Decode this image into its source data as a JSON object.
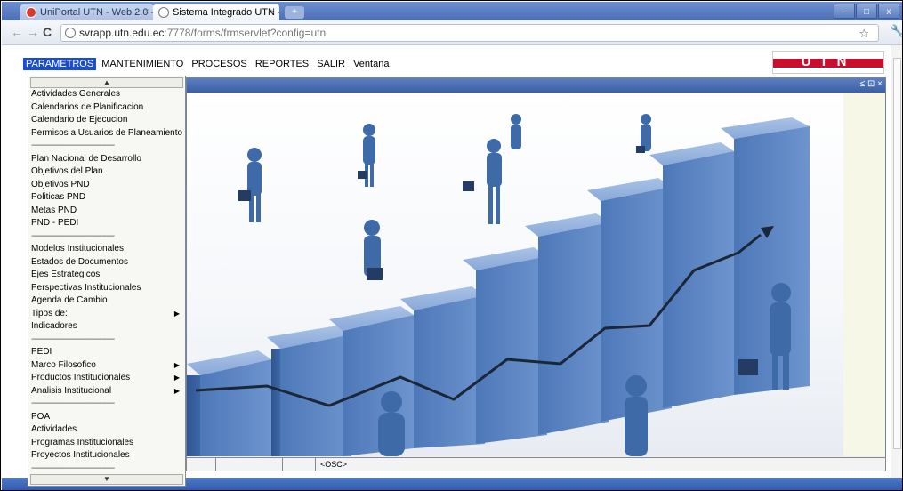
{
  "browser": {
    "tabs": [
      {
        "title": "UniPortal UTN - Web 2.0 - I",
        "close": "×"
      },
      {
        "title": "Sistema Integrado UTN - W",
        "close": "×"
      }
    ],
    "new_tab": "+",
    "url_host": "svrapp.utn.edu.ec",
    "url_path": ":7778/forms/frmservlet?config=utn",
    "window_buttons": [
      "–",
      "□",
      "x"
    ]
  },
  "menubar": {
    "items": [
      {
        "label": "PARAMETROS",
        "active": true
      },
      {
        "label": "MANTENIMIENTO"
      },
      {
        "label": "PROCESOS"
      },
      {
        "label": "REPORTES"
      },
      {
        "label": "SALIR"
      },
      {
        "label": "Ventana"
      }
    ]
  },
  "logo": {
    "text": "UTN"
  },
  "form": {
    "title_controls": "≤ ⊡ ×"
  },
  "dropdown": {
    "items": [
      {
        "label": "Actividades Generales"
      },
      {
        "label": "Calendarios de Planificacion"
      },
      {
        "label": "Calendario de Ejecucion"
      },
      {
        "label": "Permisos a Usuarios de Planeamiento"
      },
      {
        "sep": true
      },
      {
        "label": "Plan Nacional de Desarrollo"
      },
      {
        "label": "Objetivos del Plan"
      },
      {
        "label": "Objetivos PND"
      },
      {
        "label": "Politicas PND"
      },
      {
        "label": "Metas PND"
      },
      {
        "label": "PND - PEDI"
      },
      {
        "sep": true
      },
      {
        "label": "Modelos Institucionales"
      },
      {
        "label": "Estados de Documentos"
      },
      {
        "label": "Ejes Estrategicos"
      },
      {
        "label": "Perspectivas Institucionales"
      },
      {
        "label": "Agenda de Cambio"
      },
      {
        "label": "Tipos de:",
        "submenu": true
      },
      {
        "label": "Indicadores"
      },
      {
        "sep": true
      },
      {
        "label": "PEDI"
      },
      {
        "label": "Marco Filosofico",
        "submenu": true
      },
      {
        "label": "Productos Institucionales",
        "submenu": true
      },
      {
        "label": "Analisis Institucional",
        "submenu": true
      },
      {
        "sep": true
      },
      {
        "label": "POA"
      },
      {
        "label": "Actividades"
      },
      {
        "label": "Programas Institucionales"
      },
      {
        "label": "Proyectos Institucionales"
      },
      {
        "sep": true
      }
    ],
    "separator_text": "----------------------------------------"
  },
  "status": {
    "osc": "<OSC>"
  },
  "colors": {
    "menu_active": "#1a4dd0",
    "form_title": "#3a5fa3",
    "bar": "#5b86c4"
  }
}
